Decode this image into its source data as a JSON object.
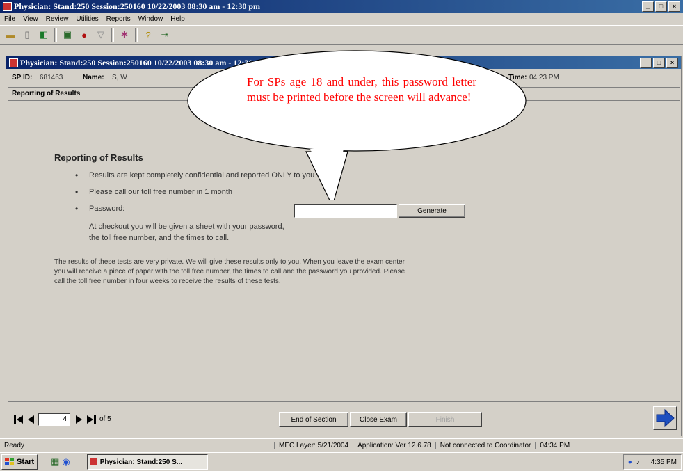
{
  "app": {
    "title": "Physician: Stand:250 Session:250160 10/22/2003 08:30 am - 12:30 pm",
    "menu": [
      "File",
      "View",
      "Review",
      "Utilities",
      "Reports",
      "Window",
      "Help"
    ]
  },
  "child_window": {
    "title": "Physician: Stand:250 Session:250160 10/22/2003 08:30 am - 12:30 pm"
  },
  "header": {
    "sp_id_label": "SP ID:",
    "sp_id_value": "681463",
    "name_label": "Name:",
    "name_value": "S, W",
    "time_label": "Time:",
    "time_value": "04:23 PM",
    "section_title": "Reporting of Results"
  },
  "callout": {
    "text": "For SPs age 18 and under, this password letter must be printed before the screen will advance!",
    "color": "#ff0000"
  },
  "main": {
    "heading": "Reporting of Results",
    "bullets": [
      "Results are kept completely confidential and reported ONLY to you",
      "Please call our toll free number in 1 month",
      "Password:"
    ],
    "bullet_glyph": "•",
    "password_value": "",
    "generate_label": "Generate",
    "checkout_line1": "At checkout you will be given a sheet with your password,",
    "checkout_line2": "the toll free number, and the times to call.",
    "para_line1": "The results of these tests are very private.  We will give these results only to you. When you leave the exam center",
    "para_line2": "you will receive a piece of paper with the toll free number, the times to call and the password you provided. Please",
    "para_line3": "call the toll free number in four weeks to receive the results of these tests."
  },
  "pager": {
    "current": "4",
    "of_label": "of 5"
  },
  "bottom_buttons": {
    "end_of_section": "End of Section",
    "close_exam": "Close Exam",
    "finish": "Finish"
  },
  "status": {
    "ready": "Ready",
    "mec_layer": "MEC Layer: 5/21/2004",
    "application": "Application: Ver 12.6.78",
    "coordinator": "Not connected to Coordinator",
    "time": "04:34 PM"
  },
  "taskbar": {
    "start_label": "Start",
    "task_label": "Physician: Stand:250 S...",
    "clock": "4:35 PM"
  },
  "colors": {
    "titlebar": "#0a246a",
    "callout_text": "#ff0000",
    "next_arrow": "#1e4fbf"
  }
}
